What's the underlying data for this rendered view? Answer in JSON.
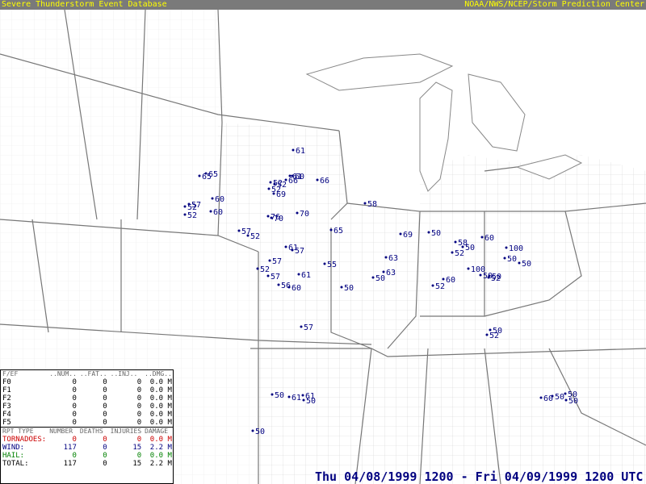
{
  "header": {
    "left": "Severe Thunderstorm Event Database",
    "right": "NOAA/NWS/NCEP/Storm Prediction Center"
  },
  "datetime": "Thu 04/08/1999 1200 - Fri 04/09/1999 1200 UTC",
  "fscale": {
    "header": [
      "F/EF",
      "..NUM..",
      "..FAT..",
      "..INJ..",
      "..DMG.."
    ],
    "rows": [
      {
        "label": "F0",
        "num": "0",
        "fat": "0",
        "inj": "0",
        "dmg": "0.0 M"
      },
      {
        "label": "F1",
        "num": "0",
        "fat": "0",
        "inj": "0",
        "dmg": "0.0 M"
      },
      {
        "label": "F2",
        "num": "0",
        "fat": "0",
        "inj": "0",
        "dmg": "0.0 M"
      },
      {
        "label": "F3",
        "num": "0",
        "fat": "0",
        "inj": "0",
        "dmg": "0.0 M"
      },
      {
        "label": "F4",
        "num": "0",
        "fat": "0",
        "inj": "0",
        "dmg": "0.0 M"
      },
      {
        "label": "F5",
        "num": "0",
        "fat": "0",
        "inj": "0",
        "dmg": "0.0 M"
      }
    ]
  },
  "summary": {
    "header": [
      "RPT TYPE",
      "NUMBER",
      "DEATHS",
      "INJURIES",
      "DAMAGE"
    ],
    "rows": [
      {
        "label": "TORNADOES:",
        "number": "0",
        "deaths": "0",
        "injuries": "0",
        "damage": "0.0 M",
        "color": "#cc0000"
      },
      {
        "label": "WIND:",
        "number": "117",
        "deaths": "0",
        "injuries": "15",
        "damage": "2.2 M",
        "color": "#000080"
      },
      {
        "label": "HAIL:",
        "number": "0",
        "deaths": "0",
        "injuries": "0",
        "damage": "0.0 M",
        "color": "#008000"
      },
      {
        "label": "TOTAL:",
        "number": "117",
        "deaths": "0",
        "injuries": "15",
        "damage": "2.2 M",
        "color": "#000000"
      }
    ]
  },
  "colors": {
    "wind": "#000080",
    "borders": "#888888",
    "counties": "#c8c8c8"
  },
  "wind_reports": [
    "61",
    "65",
    "65",
    "61",
    "52",
    "52",
    "66",
    "60",
    "66",
    "69",
    "52",
    "57",
    "52",
    "60",
    "52",
    "60",
    "70",
    "76",
    "70",
    "58",
    "57",
    "52",
    "65",
    "69",
    "50",
    "58",
    "61",
    "57",
    "57",
    "52",
    "55",
    "61",
    "57",
    "56",
    "60",
    "50",
    "63",
    "63",
    "50",
    "52",
    "52",
    "60",
    "60",
    "50",
    "100",
    "100",
    "50",
    "50",
    "50",
    "50",
    "52",
    "57",
    "50",
    "61",
    "61",
    "50",
    "50",
    "52",
    "50",
    "60",
    "50",
    "50",
    "50"
  ]
}
